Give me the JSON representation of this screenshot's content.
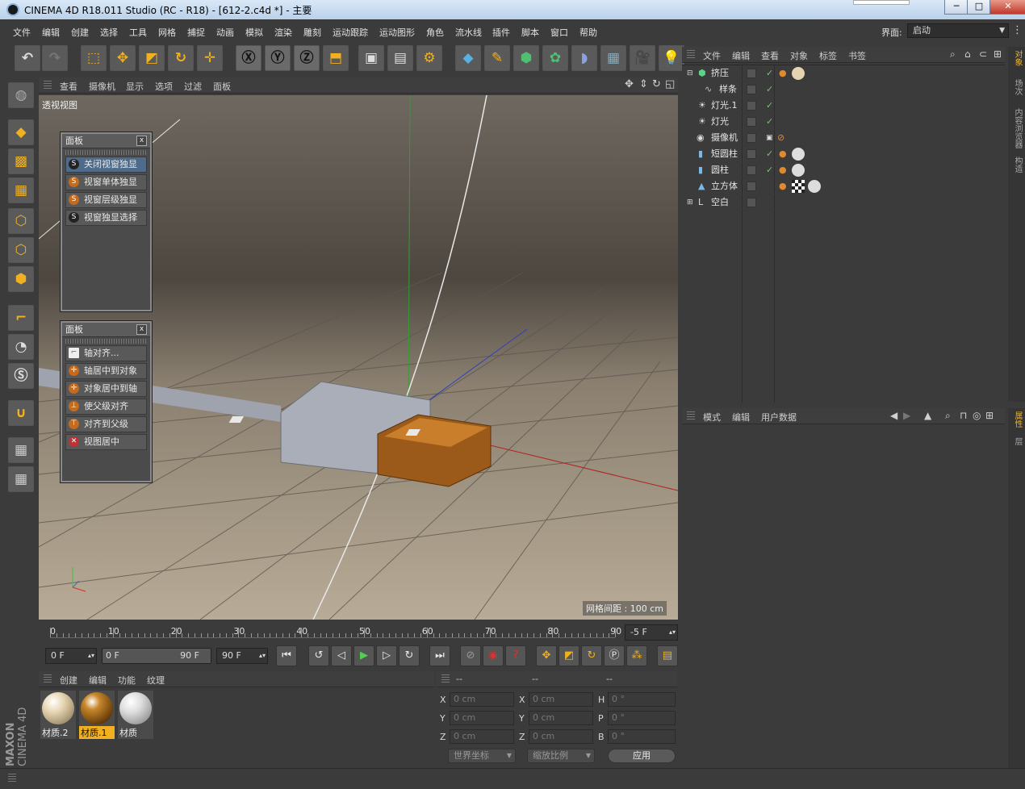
{
  "window": {
    "title": "CINEMA 4D R18.011 Studio (RC - R18) - [612-2.c4d *] - 主要",
    "min": "─",
    "max": "□",
    "close": "✕"
  },
  "menu": [
    "文件",
    "编辑",
    "创建",
    "选择",
    "工具",
    "网格",
    "捕捉",
    "动画",
    "模拟",
    "渲染",
    "雕刻",
    "运动跟踪",
    "运动图形",
    "角色",
    "流水线",
    "插件",
    "脚本",
    "窗口",
    "帮助"
  ],
  "layout": {
    "label": "界面:",
    "value": "启动"
  },
  "viewport": {
    "menu": [
      "查看",
      "摄像机",
      "显示",
      "选项",
      "过滤",
      "面板"
    ],
    "name": "透视视图",
    "grid_spacing": "网格间距 : 100 cm"
  },
  "panel1": {
    "title": "面板",
    "items": [
      {
        "icon": "S",
        "label": "关闭视窗独显"
      },
      {
        "icon": "S",
        "label": "视窗单体独显"
      },
      {
        "icon": "S",
        "label": "视窗层级独显"
      },
      {
        "icon": "S",
        "label": "视窗独显选择"
      }
    ]
  },
  "panel2": {
    "title": "面板",
    "items": [
      "轴对齐...",
      "轴居中到对象",
      "对象居中到轴",
      "使父级对齐",
      "对齐到父级",
      "视图居中"
    ]
  },
  "objects": {
    "menu": [
      "文件",
      "编辑",
      "查看",
      "对象",
      "标签",
      "书签"
    ],
    "rows": [
      {
        "name": "挤压",
        "depth": 0
      },
      {
        "name": "样条",
        "depth": 1
      },
      {
        "name": "灯光.1",
        "depth": 0
      },
      {
        "name": "灯光",
        "depth": 0
      },
      {
        "name": "摄像机",
        "depth": 0
      },
      {
        "name": "短圆柱",
        "depth": 0
      },
      {
        "name": "圆柱",
        "depth": 0
      },
      {
        "name": "立方体",
        "depth": 0
      },
      {
        "name": "空白",
        "depth": 0
      }
    ]
  },
  "attributes": {
    "menu": [
      "模式",
      "编辑",
      "用户数据"
    ]
  },
  "timeline": {
    "ticks": [
      "0",
      "10",
      "20",
      "30",
      "40",
      "50",
      "60",
      "70",
      "80",
      "90"
    ],
    "current": "-5 F",
    "start": "0 F",
    "range_start": "0 F",
    "range_end": "90 F",
    "end": "90 F"
  },
  "materials": {
    "menu": [
      "创建",
      "编辑",
      "功能",
      "纹理"
    ],
    "items": [
      {
        "name": "材质.2",
        "color": "#e6d4b0"
      },
      {
        "name": "材质.1",
        "color": "#8a5a1c"
      },
      {
        "name": "材质",
        "color": "#e8e8e8"
      }
    ]
  },
  "coords": {
    "headers": [
      "--",
      "--",
      "--"
    ],
    "rows": [
      {
        "a": "X",
        "av": "0 cm",
        "b": "X",
        "bv": "0 cm",
        "c": "H",
        "cv": "0 °"
      },
      {
        "a": "Y",
        "av": "0 cm",
        "b": "Y",
        "bv": "0 cm",
        "c": "P",
        "cv": "0 °"
      },
      {
        "a": "Z",
        "av": "0 cm",
        "b": "Z",
        "bv": "0 cm",
        "c": "B",
        "cv": "0 °"
      }
    ],
    "world": "世界坐标",
    "scale": "缩放比例",
    "apply": "应用"
  },
  "right_tabs": [
    "对象",
    "场次",
    "内容浏览器",
    "构造"
  ],
  "attr_tabs": [
    "属性",
    "层"
  ],
  "brand": {
    "maxon": "MAXON",
    "product": "CINEMA 4D"
  }
}
